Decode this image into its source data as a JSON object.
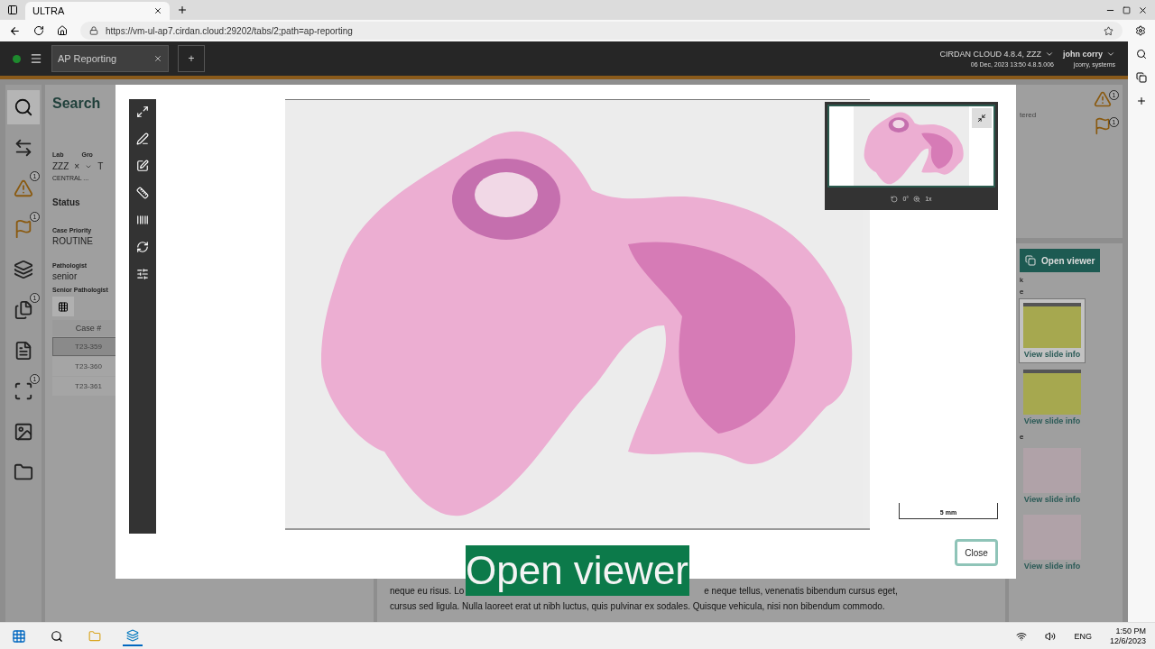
{
  "browser": {
    "tabs": [
      {
        "title": "ULTRA",
        "selected": true
      }
    ],
    "url": "https://vm-ul-ap7.cirdan.cloud:29202/tabs/2;path=ap-reporting"
  },
  "app_header": {
    "tabs": [
      {
        "label": "AP Reporting",
        "selected": true
      }
    ],
    "add_tab": "+",
    "server": "CIRDAN CLOUD 4.8.4, ZZZ",
    "server_info": "06 Dec, 2023 13:50 4.8.5.006",
    "user": "john corry",
    "user_info": "jcorry, systems"
  },
  "nav_rail": [
    {
      "kind": "search",
      "selected": true
    },
    {
      "kind": "swap",
      "selected": false
    },
    {
      "kind": "warning",
      "selected": false,
      "badge": "1"
    },
    {
      "kind": "flag",
      "selected": false,
      "badge": "1"
    },
    {
      "kind": "slides",
      "selected": false
    },
    {
      "kind": "files",
      "selected": false,
      "badge": "1"
    },
    {
      "kind": "report",
      "selected": false
    },
    {
      "kind": "frame",
      "selected": false,
      "badge": "1"
    },
    {
      "kind": "image",
      "selected": false
    },
    {
      "kind": "folder",
      "selected": false
    }
  ],
  "search_panel": {
    "title": "Search",
    "lab_label": "Lab",
    "group_label": "Gro",
    "lab_value": "ZZZ",
    "clear": "×",
    "group_value": "T",
    "lab_name": "CENTRAL ...",
    "status_heading": "Status",
    "fields": [
      {
        "label": "Case Priority",
        "value": "ROUTINE"
      },
      {
        "label": "Pathologist",
        "value": "senior"
      }
    ],
    "senior_label": "Senior Pathologist",
    "table": {
      "columns": [
        "Case #"
      ],
      "rows": [
        {
          "case": "T23-359",
          "selected": true
        },
        {
          "case": "T23-360",
          "selected": false
        },
        {
          "case": "T23-361",
          "selected": false
        }
      ]
    }
  },
  "notes_panel": {
    "line_1_start": "neque eu risus. Lo",
    "line_1_end": "e neque tellus, venenatis bibendum cursus eget,",
    "line_2": "cursus sed ligula. Nulla laoreet erat ut nibh luctus, quis pulvinar ex sodales. Quisque vehicula, nisi non bibendum commodo."
  },
  "right_panel": {
    "status_text": "tered",
    "alerts": [
      {
        "kind": "warning",
        "badge": "1"
      },
      {
        "kind": "flag",
        "badge": "1"
      }
    ],
    "open_viewer": "Open viewer",
    "section_1": "k",
    "section_2": "e",
    "section_3": "e",
    "slides": [
      {
        "kind": "label",
        "selected": true,
        "link": "View slide info"
      },
      {
        "kind": "label",
        "selected": false,
        "link": "View slide info"
      },
      {
        "kind": "tissue",
        "selected": false,
        "link": "View slide info"
      },
      {
        "kind": "tissue",
        "selected": false,
        "link": "View slide info"
      }
    ]
  },
  "viewer": {
    "tools": [
      {
        "kind": "expand"
      },
      {
        "kind": "annotate"
      },
      {
        "kind": "edit"
      },
      {
        "kind": "measure"
      },
      {
        "kind": "barcode"
      },
      {
        "kind": "rotate"
      },
      {
        "kind": "settings"
      }
    ],
    "thumbnail": {
      "rotation": "0°",
      "zoom": "1x"
    },
    "scale": "5 mm",
    "close": "Close"
  },
  "caption": "Open viewer",
  "taskbar": {
    "language": "ENG",
    "time": "1:50 PM",
    "date": "12/6/2023"
  }
}
